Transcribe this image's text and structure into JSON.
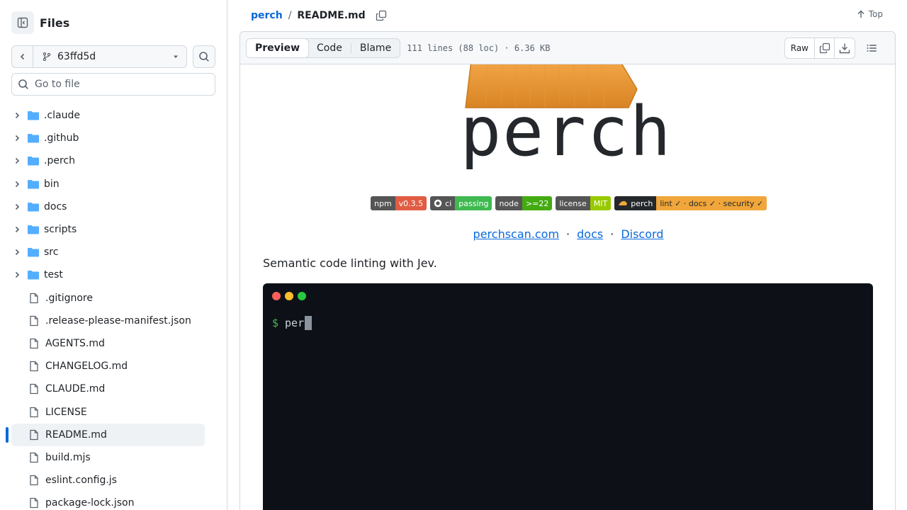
{
  "sidebar": {
    "title": "Files",
    "branch": "63ffd5d",
    "goto_placeholder": "Go to file",
    "folders": [
      ".claude",
      ".github",
      ".perch",
      "bin",
      "docs",
      "scripts",
      "src",
      "test"
    ],
    "files": [
      ".gitignore",
      ".release-please-manifest.json",
      "AGENTS.md",
      "CHANGELOG.md",
      "CLAUDE.md",
      "LICENSE",
      "README.md",
      "build.mjs",
      "eslint.config.js",
      "package-lock.json"
    ],
    "selected_file": "README.md"
  },
  "header": {
    "repo": "perch",
    "separator": "/",
    "file": "README.md",
    "top_label": "Top"
  },
  "filebar": {
    "tabs": [
      "Preview",
      "Code",
      "Blame"
    ],
    "active_tab": "Preview",
    "meta": "111 lines (88 loc) · 6.36 KB",
    "raw_label": "Raw"
  },
  "readme": {
    "logo_text": "perch",
    "badges": [
      {
        "label": "npm",
        "value": "v0.3.5",
        "color": "#e05d44"
      },
      {
        "label": "ci",
        "value": "passing",
        "color": "#4c1"
      },
      {
        "label": "node",
        "value": ">=22",
        "color": "#44cc11"
      },
      {
        "label": "license",
        "value": "MIT",
        "color": "#97ca00"
      },
      {
        "label": "perch",
        "value": "lint ✓ · docs ✓ · security ✓",
        "color": "#f0a63a"
      }
    ],
    "links": [
      "perchscan.com",
      "docs",
      "Discord"
    ],
    "link_sep": "·",
    "description": "Semantic code linting with Jev.",
    "terminal": {
      "prompt": "$",
      "text": "per",
      "dot_colors": [
        "#ff5f56",
        "#ffbd2e",
        "#27c93f"
      ]
    }
  }
}
